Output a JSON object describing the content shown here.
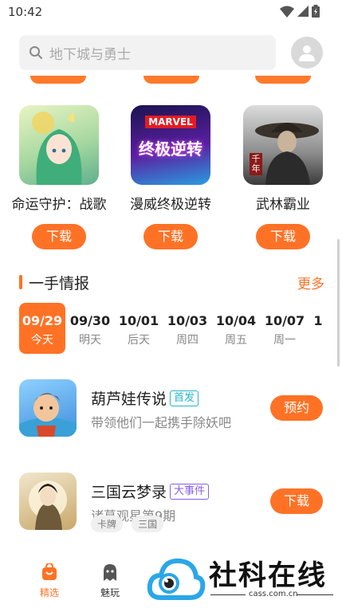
{
  "status_bar": {
    "time": "10:42"
  },
  "search": {
    "placeholder": "地下城与勇士"
  },
  "games": [
    {
      "name": "命运守护：战歌",
      "button": "下载"
    },
    {
      "name": "漫威终极逆转",
      "button": "下载",
      "thumb_text": "MARVEL",
      "thumb_title": "终极逆转"
    },
    {
      "name": "武林霸业",
      "button": "下载",
      "thumb_text": "千年"
    }
  ],
  "news_section": {
    "title": "一手情报",
    "more": "更多",
    "dates": [
      {
        "date": "09/29",
        "weekday": "今天",
        "active": true
      },
      {
        "date": "09/30",
        "weekday": "明天"
      },
      {
        "date": "10/01",
        "weekday": "后天"
      },
      {
        "date": "10/03",
        "weekday": "周四"
      },
      {
        "date": "10/04",
        "weekday": "周五"
      },
      {
        "date": "10/07",
        "weekday": "周一"
      },
      {
        "date": "1",
        "weekday": ""
      }
    ],
    "items": [
      {
        "title": "葫芦娃传说",
        "tag": "首发",
        "subtitle": "带领他们一起携手除妖吧",
        "action": "预约",
        "chips": []
      },
      {
        "title": "三国云梦录",
        "tag": "大事件",
        "subtitle": "诸葛观星第9期",
        "action": "下载",
        "chips": [
          "卡牌",
          "三国"
        ]
      }
    ]
  },
  "bottom_nav": [
    {
      "label": "精选",
      "active": true
    },
    {
      "label": "魅玩"
    }
  ],
  "watermark": {
    "text": "社科在线",
    "domain": "cass.com.cn"
  },
  "colors": {
    "accent": "#ff7226",
    "tag_cyan": "#26b5c7",
    "tag_purple": "#8a5ee6",
    "watermark_blue": "#2aa7e8"
  }
}
